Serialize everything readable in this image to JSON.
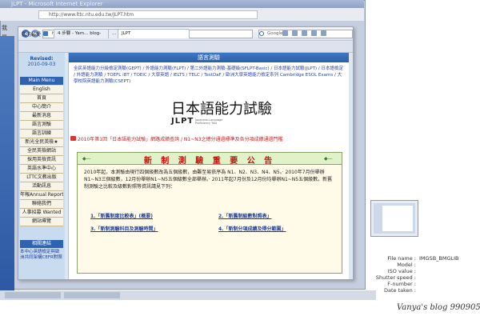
{
  "back_window": {
    "title": "JLPT - Microsoft Internet Explorer",
    "address": "http://www.lttc.ntu.edu.tw/JLPT.htm",
    "fav_label": "我",
    "fav_label2": "最"
  },
  "browser": {
    "address": "http://www.lttc.ntu.edu.tw/JLPT.htm",
    "search_placeholder": "Google",
    "favorites_label": "我的最愛",
    "tabs": [
      {
        "label": "4 步驟 - Yam… blog-"
      },
      {
        "label": "…"
      },
      {
        "label": "JLPT"
      }
    ]
  },
  "left_menu": {
    "revised_label": "Revised:",
    "revised_date": "2010-09-03",
    "head": "Main Menu",
    "items": [
      "English",
      "首頁",
      "中心簡介",
      "最新消息",
      "語言測驗",
      "語言訓練",
      "新光全民英檢★",
      "全民英檢網站",
      "採用英檢資訊",
      "英語水準中心",
      "LTTC文教出版",
      "活動訊息",
      "年報Annual Report",
      "聯絡我們",
      "人事招募 Wanted",
      "網站導覽"
    ],
    "links_head": "相關連結",
    "link_1": "本中心英語檢定與歐洲共同架構CEFR對照"
  },
  "main": {
    "section_title": "語言測驗",
    "top_links": "全民英語能力分級檢定測驗(GEPT) / 外語能力測驗(FLPT) / 第二外語能力測驗-基礎級(SFLPT-Basic) / 日本語能力試驗(JLPT) / 日本語檢定 / 外語能力測驗 / TOEFL iBT / TOEIC / 大學英語 / IELTS / TELC / TestDaF / 歐洲大學英語能力檢定系列 Cambridge ESOL Exams / 大學校院英語能力測驗(CSEPT)",
    "logo_cn": "日本語能力試驗",
    "logo_jlpt": "JLPT",
    "logo_sub": "Japanese-Language Proficiency Test",
    "notice": "2010年第1回「日本語能力試驗」網路成績查詢 / N1~N3之總分通過標準及各分項成績通過門檻",
    "announce_title": "新 制 測 驗 重 要 公 告",
    "announce_deco": "◆—",
    "announce_body": "2010年起，本測驗由現行四個級數改為五個級數，由難至易依序為 N1、N2、N3、N4、N5。‧ 2010年7月份舉辦N1~N3三個級數，12月份舉辦N1~N5五個級數全部舉辦。‧ 2011年起7月份及12月份均舉辦N1~N5五個級數。新舊制測驗之比較及級數對照等資訊請見下列：",
    "announce_links": [
      "1.「新舊制度比較表」(概要)",
      "2.「新舊制級數對照表」",
      "3.「新制測驗科目及測驗時間」",
      "4.「新制分項成績及得分範圍」"
    ]
  },
  "info": {
    "rows": [
      {
        "k": "File name :",
        "v": "IMGSB_BMGLIB"
      },
      {
        "k": "Model :",
        "v": ""
      },
      {
        "k": "ISO value :",
        "v": ""
      },
      {
        "k": "Shutter speed :",
        "v": ""
      },
      {
        "k": "F-number :",
        "v": ""
      },
      {
        "k": "Date taken :",
        "v": ""
      }
    ],
    "signature": "Vanya's blog 990905"
  }
}
